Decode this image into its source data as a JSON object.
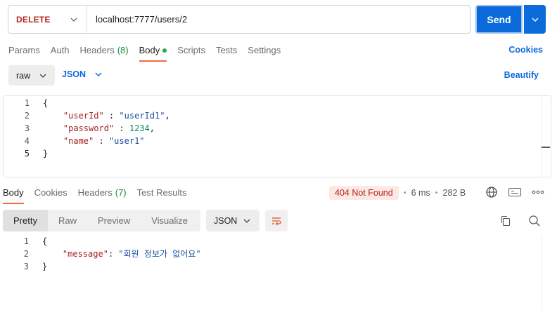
{
  "request": {
    "method": "DELETE",
    "url": "localhost:7777/users/2",
    "send_label": "Send"
  },
  "request_tabs": [
    {
      "label": "Params"
    },
    {
      "label": "Auth"
    },
    {
      "label": "Headers",
      "count": "(8)"
    },
    {
      "label": "Body"
    },
    {
      "label": "Scripts"
    },
    {
      "label": "Tests"
    },
    {
      "label": "Settings"
    }
  ],
  "cookies_label": "Cookies",
  "body_options": {
    "mode": "raw",
    "language": "JSON",
    "beautify_label": "Beautify"
  },
  "request_body_lines": [
    {
      "n": "1"
    },
    {
      "n": "2",
      "key": "\"userId\"",
      "sep": " : ",
      "val": "\"userId1\"",
      "end": ","
    },
    {
      "n": "3",
      "key": "\"password\"",
      "sep": " : ",
      "val": "1234",
      "end": ","
    },
    {
      "n": "4",
      "key": "\"name\"",
      "sep": " : ",
      "val": "\"user1\""
    },
    {
      "n": "5"
    }
  ],
  "response_tabs": [
    {
      "label": "Body"
    },
    {
      "label": "Cookies"
    },
    {
      "label": "Headers",
      "count": "(7)"
    },
    {
      "label": "Test Results"
    }
  ],
  "response_meta": {
    "status": "404 Not Found",
    "time": "6 ms",
    "size": "282 B"
  },
  "view_modes": [
    {
      "label": "Pretty"
    },
    {
      "label": "Raw"
    },
    {
      "label": "Preview"
    },
    {
      "label": "Visualize"
    }
  ],
  "response_format": "JSON",
  "response_body_lines": [
    {
      "n": "1"
    },
    {
      "n": "2",
      "key": "\"message\"",
      "sep": ": ",
      "val": "\"회원 정보가 없어요\""
    },
    {
      "n": "3"
    }
  ],
  "colors": {
    "accent": "#0b6bdb",
    "method": "#b3261e",
    "active_tab": "#f26b3a",
    "status_error_bg": "#fde8e6"
  }
}
